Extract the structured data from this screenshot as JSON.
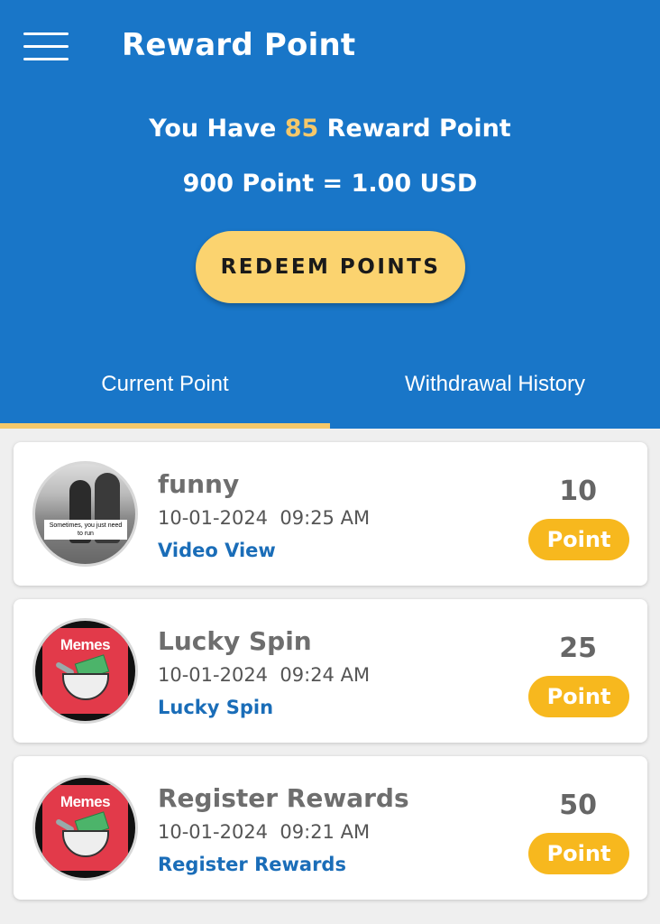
{
  "header": {
    "title": "Reward Point",
    "balance_prefix": "You Have",
    "balance_value": "85",
    "balance_suffix": "Reward Point",
    "rate_text": "900 Point = 1.00 USD",
    "redeem_label": "REDEEM POINTS",
    "accent_color": "#f5c86a",
    "bg_color": "#1976c8"
  },
  "tabs": [
    {
      "label": "Current Point",
      "active": true
    },
    {
      "label": "Withdrawal History",
      "active": false
    }
  ],
  "items": [
    {
      "title": "funny",
      "date": "10-01-2024  09:25 AM",
      "type": "Video View",
      "value": "10",
      "badge": "Point",
      "thumb": "video-thumbnail",
      "thumb_caption": "Sometimes, you just need to run"
    },
    {
      "title": "Lucky Spin",
      "date": "10-01-2024  09:24 AM",
      "type": "Lucky Spin",
      "value": "25",
      "badge": "Point",
      "thumb": "memes-logo",
      "thumb_text": "Memes"
    },
    {
      "title": "Register Rewards",
      "date": "10-01-2024  09:21 AM",
      "type": "Register Rewards",
      "value": "50",
      "badge": "Point",
      "thumb": "memes-logo",
      "thumb_text": "Memes"
    }
  ]
}
